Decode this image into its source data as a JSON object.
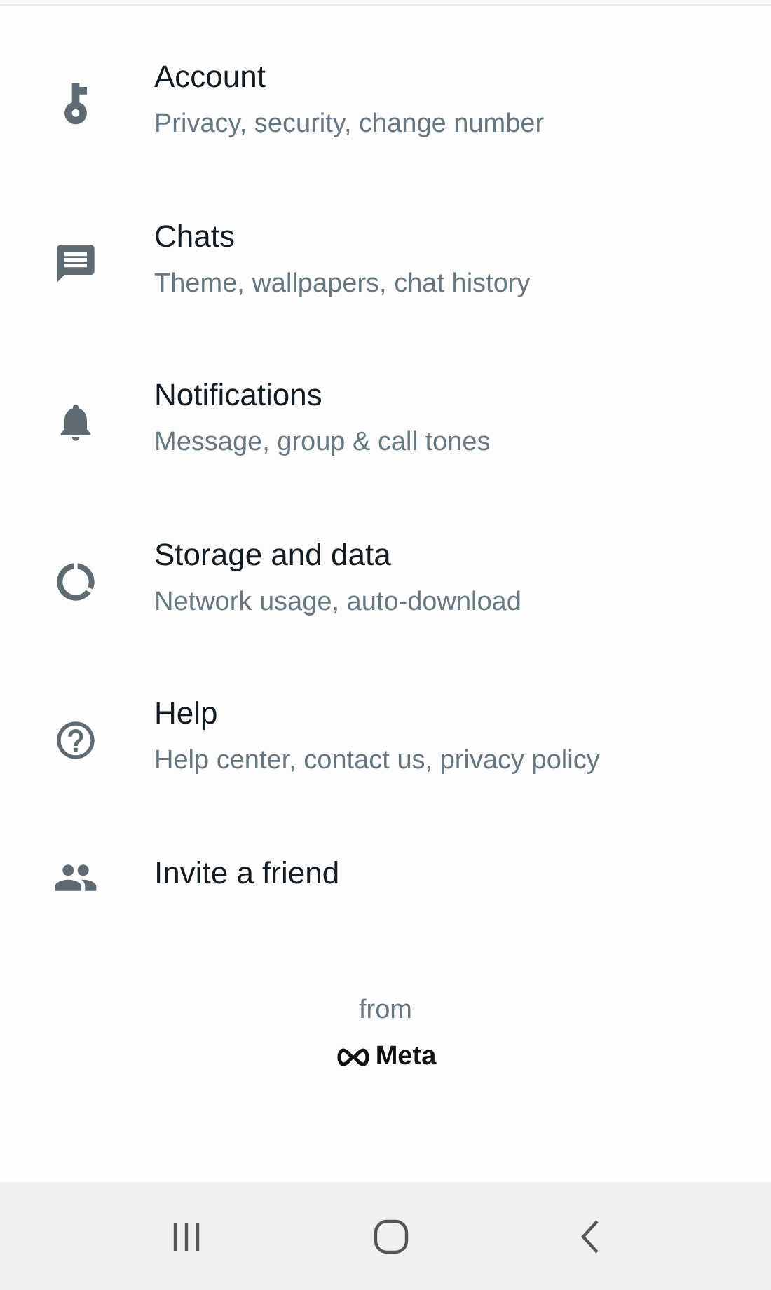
{
  "settings": [
    {
      "kind": "account",
      "title": "Account",
      "subtitle": "Privacy, security, change number"
    },
    {
      "kind": "chats",
      "title": "Chats",
      "subtitle": "Theme, wallpapers, chat history"
    },
    {
      "kind": "notifications",
      "title": "Notifications",
      "subtitle": "Message, group & call tones"
    },
    {
      "kind": "storage",
      "title": "Storage and data",
      "subtitle": "Network usage, auto-download"
    },
    {
      "kind": "help",
      "title": "Help",
      "subtitle": "Help center, contact us, privacy policy"
    },
    {
      "kind": "invite",
      "title": "Invite a friend"
    }
  ],
  "footer": {
    "from": "from",
    "brand": "Meta"
  }
}
